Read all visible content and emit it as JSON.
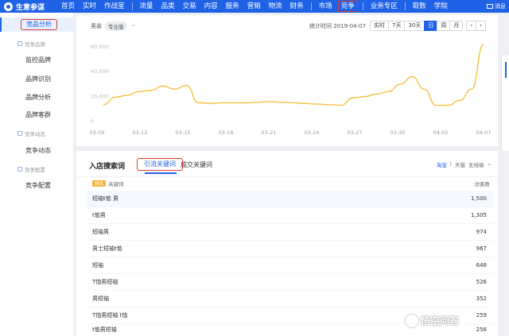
{
  "app": {
    "title": "生意参谋"
  },
  "nav": {
    "items": [
      "首页",
      "实时",
      "作战室",
      "流量",
      "品类",
      "交易",
      "内容",
      "服务",
      "营销",
      "物流",
      "财务",
      "市场",
      "竞争",
      "业务专区",
      "取数",
      "学院"
    ],
    "active_index": 12,
    "message_label": "消息"
  },
  "sidebar": {
    "active_item": "竞品分析",
    "groups": [
      {
        "label": "竞争品牌",
        "items": [
          "监控品牌",
          "品牌识别",
          "品牌分析",
          "品牌客群"
        ]
      },
      {
        "label": "竞争动态",
        "items": [
          "竞争动态"
        ]
      },
      {
        "label": "竞争配置",
        "items": [
          "竞争配置"
        ]
      }
    ]
  },
  "chart_toolbar": {
    "category_label": "男装",
    "edition_badge": "专业版",
    "date_label": "统计时间 2019-04-07",
    "buttons": [
      "实时",
      "7天",
      "30天",
      "日",
      "周",
      "月",
      "‹",
      "›"
    ],
    "active_button": "日"
  },
  "chart_data": {
    "type": "line",
    "x_ticks": [
      "03-09",
      "03-12",
      "03-15",
      "03-18",
      "03-21",
      "03-24",
      "03-27",
      "03-30",
      "04-02",
      "04-07"
    ],
    "y_ticks": [
      "60,000",
      "40,000",
      "20,000",
      "0"
    ],
    "ylim": [
      0,
      65000
    ],
    "grid": false,
    "color": "#f5c242",
    "series": [
      {
        "values": [
          13500,
          19500,
          21000,
          24000,
          25000,
          28500,
          26000,
          29000,
          15000,
          14500,
          15000,
          15000,
          15000,
          15500,
          16000,
          15500,
          15000,
          14500,
          14000,
          13500,
          13000,
          19000,
          20000,
          22000,
          24000,
          30000,
          36000,
          26000,
          13000,
          13000,
          17000,
          26000,
          62000
        ]
      }
    ]
  },
  "keywords": {
    "title": "入店搜索词",
    "tab_active": "引流关键词",
    "tab_other": "成交关键词",
    "right_options": [
      "淘宝",
      "天猫",
      "无线端"
    ],
    "rank_badge": "排名",
    "col_keyword": "关键词",
    "col_visits": "访客数",
    "rows": [
      {
        "keyword": "短袖t恤 男",
        "visits": "1,500"
      },
      {
        "keyword": "t恤男",
        "visits": "1,305"
      },
      {
        "keyword": "短袖男",
        "visits": "974"
      },
      {
        "keyword": "男士短袖t恤",
        "visits": "967"
      },
      {
        "keyword": "短袖",
        "visits": "648"
      },
      {
        "keyword": "T恤男短袖",
        "visits": "526"
      },
      {
        "keyword": "男短袖",
        "visits": "352"
      },
      {
        "keyword": "T恤男短袖 t恤",
        "visits": "259"
      },
      {
        "keyword": "t恤男短袖",
        "visits": "256"
      }
    ]
  },
  "watermark": {
    "text": "悟空问答"
  },
  "colors": {
    "brand": "#2062e6",
    "highlight": "#e03a2b",
    "line": "#f5c242"
  }
}
